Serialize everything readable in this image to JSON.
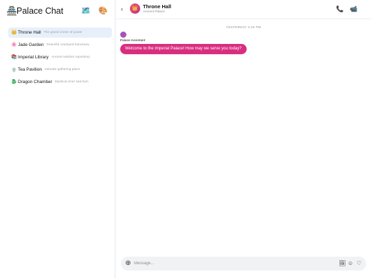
{
  "sidebar": {
    "logo": "🏯",
    "title": "Palace Chat",
    "map_icon": "🗺️",
    "palette_icon": "🎨",
    "rooms": [
      {
        "emoji": "👑",
        "name": "Throne Hall",
        "desc": "The grand center of power",
        "active": true
      },
      {
        "emoji": "🌸",
        "name": "Jade Garden",
        "desc": "Peaceful courtyard sanctuary",
        "active": false
      },
      {
        "emoji": "📚",
        "name": "Imperial Library",
        "desc": "Ancient wisdom repository",
        "active": false
      },
      {
        "emoji": "🍵",
        "name": "Tea Pavilion",
        "desc": "Intimate gathering place",
        "active": false
      },
      {
        "emoji": "🐉",
        "name": "Dragon Chamber",
        "desc": "Mystical inner sanctum",
        "active": false
      }
    ]
  },
  "header": {
    "back_icon": "‹",
    "avatar_emoji": "👑",
    "title": "Throne Hall",
    "subtitle": "Ancient Palace",
    "phone_icon": "📞",
    "video_icon": "📹"
  },
  "messages": {
    "day_separator": "YESTERDAY 4:16 PM",
    "items": [
      {
        "sender": "Palace Assistant",
        "text": "Welcome to the Imperial Palace! How may we serve you today?"
      }
    ]
  },
  "composer": {
    "add_icon": "⊕",
    "placeholder": "Message...",
    "image_icon": "🖼",
    "emoji_icon": "☺",
    "heart_icon": "♡"
  }
}
